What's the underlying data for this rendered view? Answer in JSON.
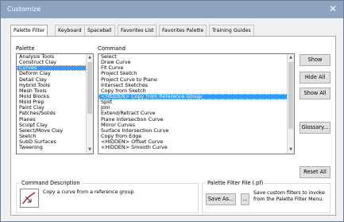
{
  "window": {
    "title": "Customize",
    "close": "✕"
  },
  "tabs": [
    "Palette Filter",
    "Keyboard",
    "Spaceball",
    "Favorites List",
    "Favorites Palette",
    "Training Guides"
  ],
  "palette": {
    "label": "Palette",
    "items": [
      "Analysis Tools",
      "Construct Clay",
      "Curves",
      "Deform Clay",
      "Detail Clay",
      "Hybrid Tools",
      "Mesh Tools",
      "Mold Blocks",
      "Mold Prep",
      "Paint Clay",
      "Patches/Solids",
      "Planes",
      "Sculpt Clay",
      "Select/Move Clay",
      "Sketch",
      "SubD Surfaces",
      "Tweening"
    ],
    "selected": "Curves"
  },
  "command": {
    "label": "Command",
    "items": [
      "Select",
      "Draw Curve",
      "Fit Curve",
      "Project Sketch",
      "Project Curve to Plane",
      "Intersect Sketches",
      "Copy from Sketch",
      "<HIDDEN> Copy from Reference Group",
      "Split",
      "Join",
      "Extend/Retract Curve",
      "Plane Intersection Curve",
      "Mirror Curves",
      "Surface Intersection Curve",
      "Copy from Edge",
      "<HIDDEN> Offset Curve",
      "<HIDDEN> Smooth Curve"
    ],
    "selected": "<HIDDEN> Copy from Reference Group"
  },
  "buttons": {
    "show": "Show",
    "hide_all": "Hide All",
    "show_all": "Show All",
    "glossary": "Glossary...",
    "reset_all": "Reset All"
  },
  "description": {
    "label": "Command Description",
    "text": "Copy a curve from a reference group."
  },
  "filter_file": {
    "label": "Palette Filter File (.pf)",
    "save_as": "Save As...",
    "browse": "...",
    "help": "Save custom filters to invoke from the Palette Filter Menu."
  }
}
